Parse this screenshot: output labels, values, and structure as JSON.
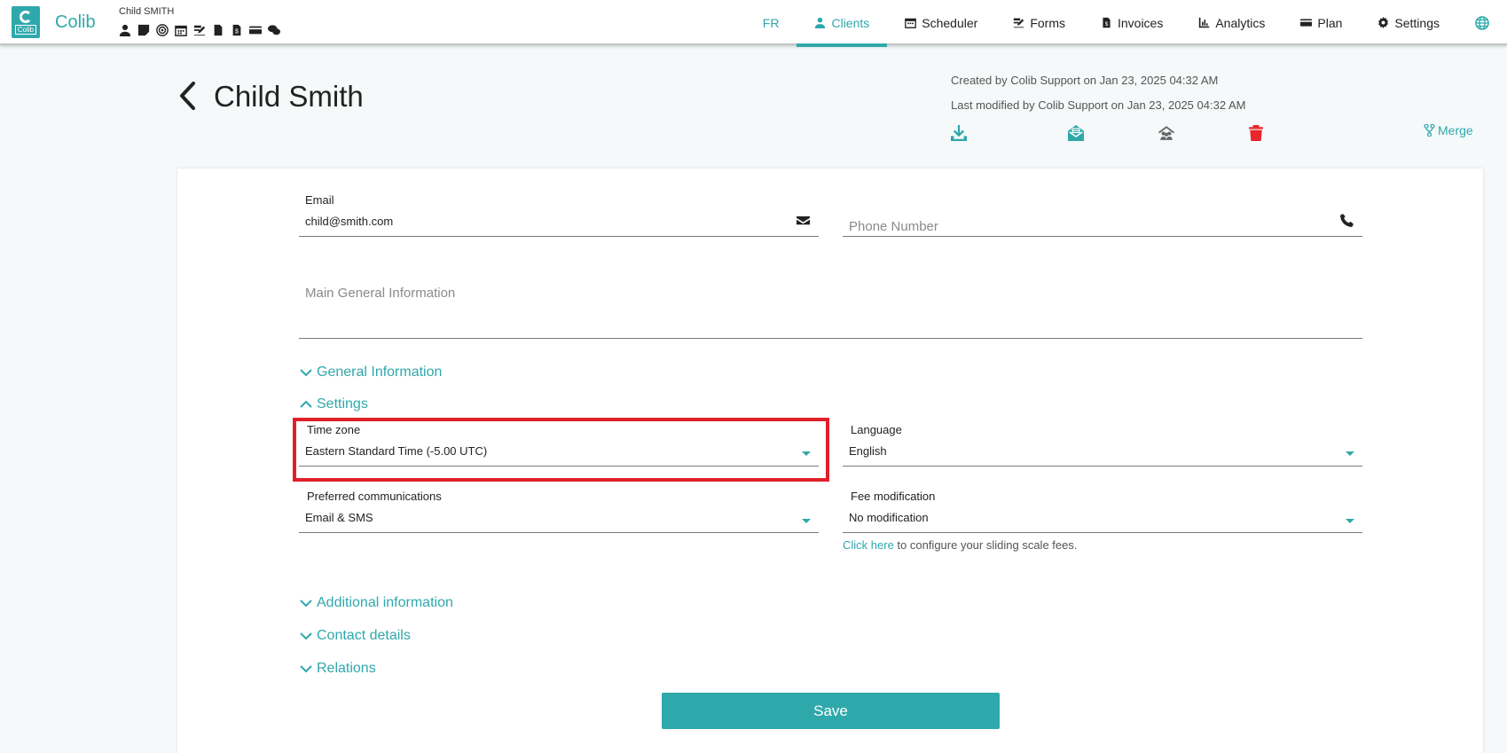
{
  "brand": {
    "name": "Colib",
    "logo_text": "Colib"
  },
  "header": {
    "client_name_small": "Child SMITH",
    "mini_icons": [
      "user-icon",
      "sticky-note-icon",
      "target-icon",
      "calendar-icon",
      "signature-icon",
      "file-icon",
      "invoice-icon",
      "credit-card-icon",
      "comments-icon"
    ]
  },
  "nav": {
    "language": "FR",
    "items": [
      {
        "label": "Clients",
        "icon": "user-icon",
        "active": true
      },
      {
        "label": "Scheduler",
        "icon": "calendar-icon"
      },
      {
        "label": "Forms",
        "icon": "signature-icon"
      },
      {
        "label": "Invoices",
        "icon": "invoice-icon"
      },
      {
        "label": "Analytics",
        "icon": "chart-icon"
      },
      {
        "label": "Plan",
        "icon": "credit-card-icon"
      },
      {
        "label": "Settings",
        "icon": "gear-icon"
      }
    ]
  },
  "page": {
    "title": "Child Smith",
    "created": "Created by Colib Support on Jan 23, 2025 04:32 AM",
    "modified": "Last modified by Colib Support on Jan 23, 2025 04:32 AM",
    "merge_label": "Merge"
  },
  "form": {
    "email": {
      "label": "Email",
      "value": "child@smith.com"
    },
    "phone": {
      "placeholder": "Phone Number"
    },
    "main_info": {
      "placeholder": "Main General Information"
    },
    "sections": {
      "general": "General Information",
      "settings": "Settings",
      "additional": "Additional information",
      "contact": "Contact details",
      "relations": "Relations"
    },
    "timezone": {
      "label": "Time zone",
      "value": "Eastern Standard Time (-5.00 UTC)"
    },
    "language": {
      "label": "Language",
      "value": "English"
    },
    "preferred": {
      "label": "Preferred communications",
      "value": "Email & SMS"
    },
    "fee": {
      "label": "Fee modification",
      "value": "No modification"
    },
    "sliding_link": "Click here",
    "sliding_text": " to configure your sliding scale fees.",
    "save_label": "Save"
  },
  "colors": {
    "accent": "#2fa8ab",
    "danger": "#e8262b",
    "highlight": "#e0202a"
  }
}
